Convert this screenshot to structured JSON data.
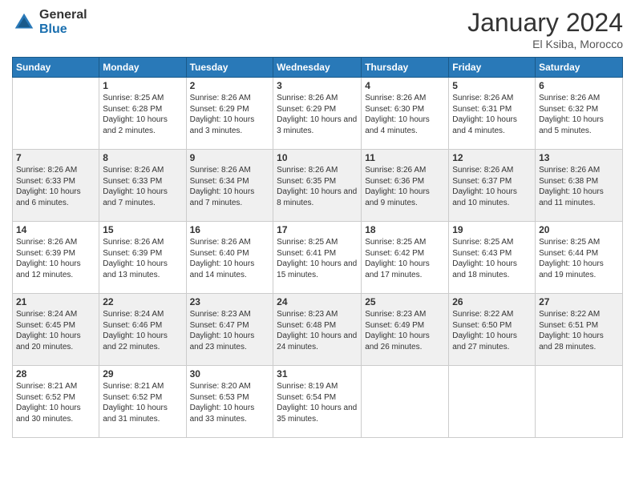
{
  "header": {
    "logo_general": "General",
    "logo_blue": "Blue",
    "month_title": "January 2024",
    "location": "El Ksiba, Morocco"
  },
  "columns": [
    "Sunday",
    "Monday",
    "Tuesday",
    "Wednesday",
    "Thursday",
    "Friday",
    "Saturday"
  ],
  "weeks": [
    [
      {
        "day": "",
        "sunrise": "",
        "sunset": "",
        "daylight": ""
      },
      {
        "day": "1",
        "sunrise": "Sunrise: 8:25 AM",
        "sunset": "Sunset: 6:28 PM",
        "daylight": "Daylight: 10 hours and 2 minutes."
      },
      {
        "day": "2",
        "sunrise": "Sunrise: 8:26 AM",
        "sunset": "Sunset: 6:29 PM",
        "daylight": "Daylight: 10 hours and 3 minutes."
      },
      {
        "day": "3",
        "sunrise": "Sunrise: 8:26 AM",
        "sunset": "Sunset: 6:29 PM",
        "daylight": "Daylight: 10 hours and 3 minutes."
      },
      {
        "day": "4",
        "sunrise": "Sunrise: 8:26 AM",
        "sunset": "Sunset: 6:30 PM",
        "daylight": "Daylight: 10 hours and 4 minutes."
      },
      {
        "day": "5",
        "sunrise": "Sunrise: 8:26 AM",
        "sunset": "Sunset: 6:31 PM",
        "daylight": "Daylight: 10 hours and 4 minutes."
      },
      {
        "day": "6",
        "sunrise": "Sunrise: 8:26 AM",
        "sunset": "Sunset: 6:32 PM",
        "daylight": "Daylight: 10 hours and 5 minutes."
      }
    ],
    [
      {
        "day": "7",
        "sunrise": "Sunrise: 8:26 AM",
        "sunset": "Sunset: 6:33 PM",
        "daylight": "Daylight: 10 hours and 6 minutes."
      },
      {
        "day": "8",
        "sunrise": "Sunrise: 8:26 AM",
        "sunset": "Sunset: 6:33 PM",
        "daylight": "Daylight: 10 hours and 7 minutes."
      },
      {
        "day": "9",
        "sunrise": "Sunrise: 8:26 AM",
        "sunset": "Sunset: 6:34 PM",
        "daylight": "Daylight: 10 hours and 7 minutes."
      },
      {
        "day": "10",
        "sunrise": "Sunrise: 8:26 AM",
        "sunset": "Sunset: 6:35 PM",
        "daylight": "Daylight: 10 hours and 8 minutes."
      },
      {
        "day": "11",
        "sunrise": "Sunrise: 8:26 AM",
        "sunset": "Sunset: 6:36 PM",
        "daylight": "Daylight: 10 hours and 9 minutes."
      },
      {
        "day": "12",
        "sunrise": "Sunrise: 8:26 AM",
        "sunset": "Sunset: 6:37 PM",
        "daylight": "Daylight: 10 hours and 10 minutes."
      },
      {
        "day": "13",
        "sunrise": "Sunrise: 8:26 AM",
        "sunset": "Sunset: 6:38 PM",
        "daylight": "Daylight: 10 hours and 11 minutes."
      }
    ],
    [
      {
        "day": "14",
        "sunrise": "Sunrise: 8:26 AM",
        "sunset": "Sunset: 6:39 PM",
        "daylight": "Daylight: 10 hours and 12 minutes."
      },
      {
        "day": "15",
        "sunrise": "Sunrise: 8:26 AM",
        "sunset": "Sunset: 6:39 PM",
        "daylight": "Daylight: 10 hours and 13 minutes."
      },
      {
        "day": "16",
        "sunrise": "Sunrise: 8:26 AM",
        "sunset": "Sunset: 6:40 PM",
        "daylight": "Daylight: 10 hours and 14 minutes."
      },
      {
        "day": "17",
        "sunrise": "Sunrise: 8:25 AM",
        "sunset": "Sunset: 6:41 PM",
        "daylight": "Daylight: 10 hours and 15 minutes."
      },
      {
        "day": "18",
        "sunrise": "Sunrise: 8:25 AM",
        "sunset": "Sunset: 6:42 PM",
        "daylight": "Daylight: 10 hours and 17 minutes."
      },
      {
        "day": "19",
        "sunrise": "Sunrise: 8:25 AM",
        "sunset": "Sunset: 6:43 PM",
        "daylight": "Daylight: 10 hours and 18 minutes."
      },
      {
        "day": "20",
        "sunrise": "Sunrise: 8:25 AM",
        "sunset": "Sunset: 6:44 PM",
        "daylight": "Daylight: 10 hours and 19 minutes."
      }
    ],
    [
      {
        "day": "21",
        "sunrise": "Sunrise: 8:24 AM",
        "sunset": "Sunset: 6:45 PM",
        "daylight": "Daylight: 10 hours and 20 minutes."
      },
      {
        "day": "22",
        "sunrise": "Sunrise: 8:24 AM",
        "sunset": "Sunset: 6:46 PM",
        "daylight": "Daylight: 10 hours and 22 minutes."
      },
      {
        "day": "23",
        "sunrise": "Sunrise: 8:23 AM",
        "sunset": "Sunset: 6:47 PM",
        "daylight": "Daylight: 10 hours and 23 minutes."
      },
      {
        "day": "24",
        "sunrise": "Sunrise: 8:23 AM",
        "sunset": "Sunset: 6:48 PM",
        "daylight": "Daylight: 10 hours and 24 minutes."
      },
      {
        "day": "25",
        "sunrise": "Sunrise: 8:23 AM",
        "sunset": "Sunset: 6:49 PM",
        "daylight": "Daylight: 10 hours and 26 minutes."
      },
      {
        "day": "26",
        "sunrise": "Sunrise: 8:22 AM",
        "sunset": "Sunset: 6:50 PM",
        "daylight": "Daylight: 10 hours and 27 minutes."
      },
      {
        "day": "27",
        "sunrise": "Sunrise: 8:22 AM",
        "sunset": "Sunset: 6:51 PM",
        "daylight": "Daylight: 10 hours and 28 minutes."
      }
    ],
    [
      {
        "day": "28",
        "sunrise": "Sunrise: 8:21 AM",
        "sunset": "Sunset: 6:52 PM",
        "daylight": "Daylight: 10 hours and 30 minutes."
      },
      {
        "day": "29",
        "sunrise": "Sunrise: 8:21 AM",
        "sunset": "Sunset: 6:52 PM",
        "daylight": "Daylight: 10 hours and 31 minutes."
      },
      {
        "day": "30",
        "sunrise": "Sunrise: 8:20 AM",
        "sunset": "Sunset: 6:53 PM",
        "daylight": "Daylight: 10 hours and 33 minutes."
      },
      {
        "day": "31",
        "sunrise": "Sunrise: 8:19 AM",
        "sunset": "Sunset: 6:54 PM",
        "daylight": "Daylight: 10 hours and 35 minutes."
      },
      {
        "day": "",
        "sunrise": "",
        "sunset": "",
        "daylight": ""
      },
      {
        "day": "",
        "sunrise": "",
        "sunset": "",
        "daylight": ""
      },
      {
        "day": "",
        "sunrise": "",
        "sunset": "",
        "daylight": ""
      }
    ]
  ]
}
